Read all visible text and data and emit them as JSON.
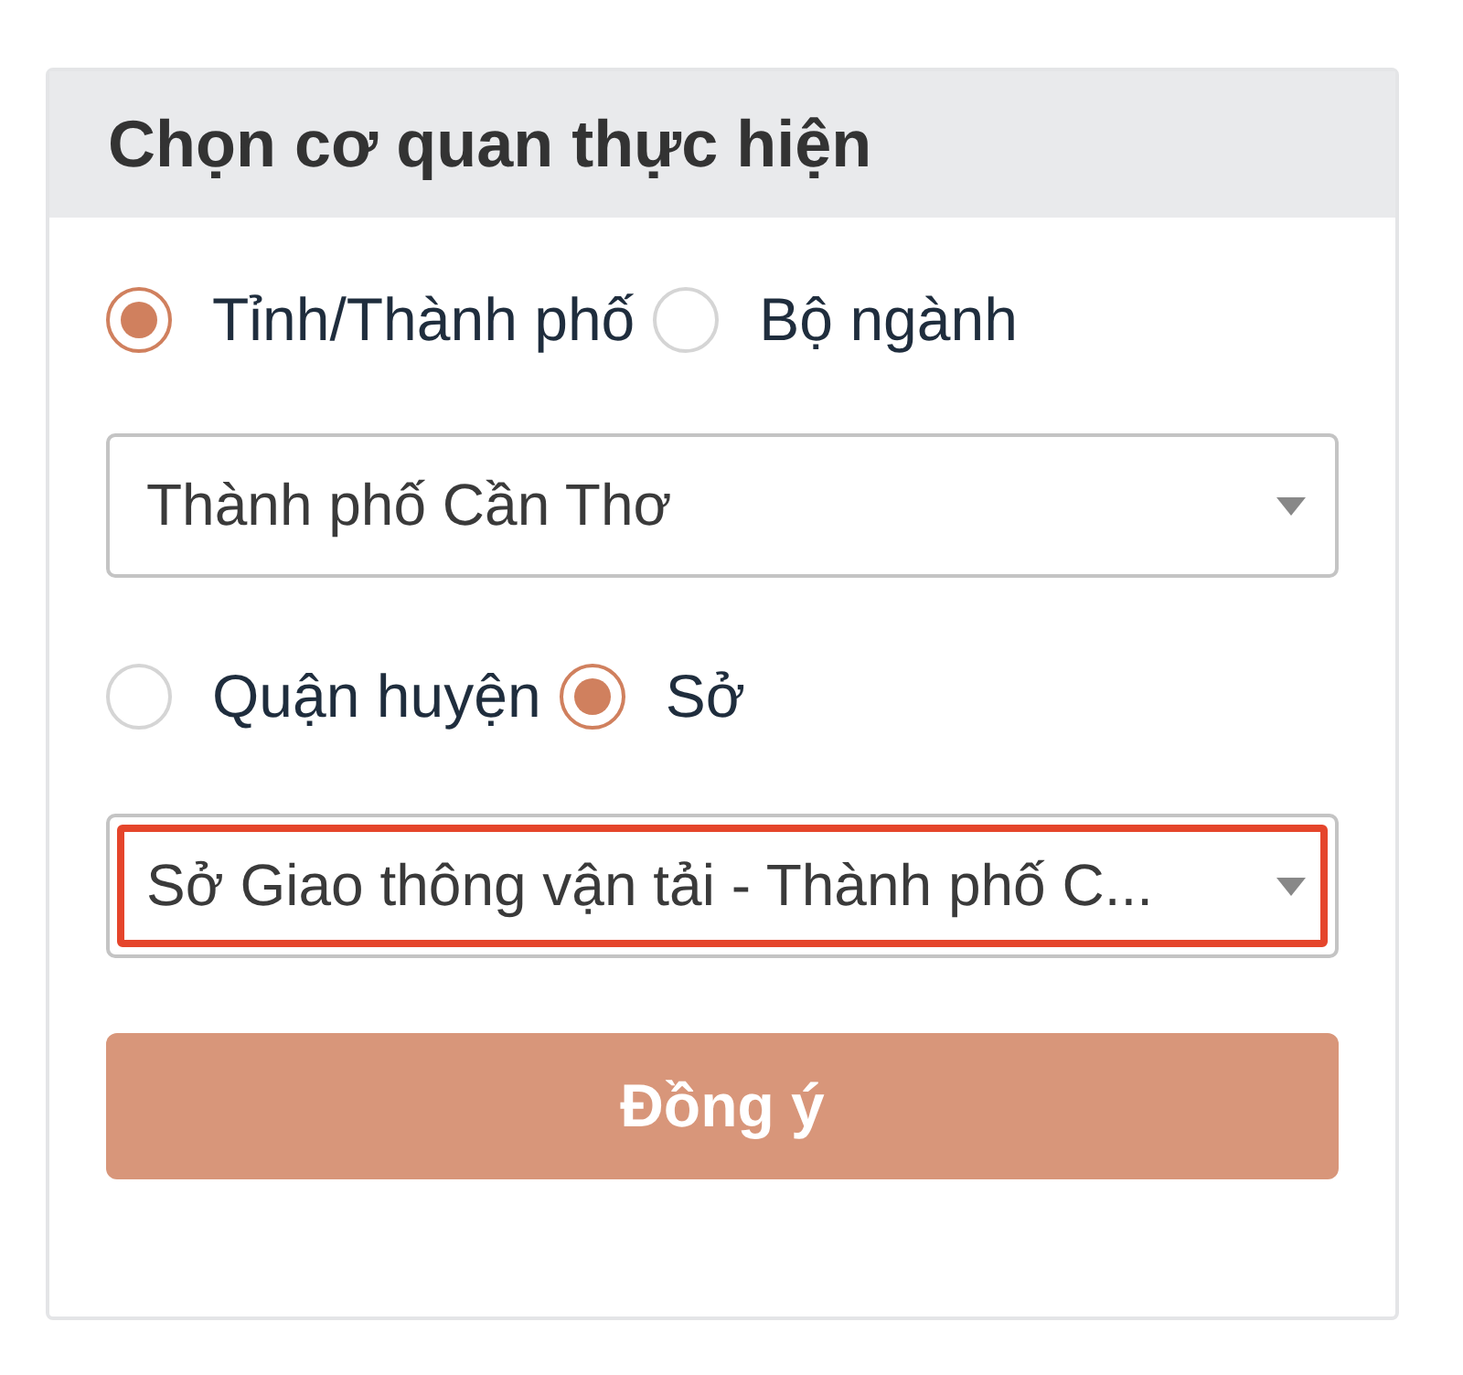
{
  "panel": {
    "title": "Chọn cơ quan thực hiện"
  },
  "level_options": [
    {
      "label": "Tỉnh/Thành phố",
      "selected": true
    },
    {
      "label": "Bộ ngành",
      "selected": false
    }
  ],
  "province_select": {
    "value": "Thành phố Cần Thơ",
    "highlighted": false
  },
  "unit_options": [
    {
      "label": "Quận huyện",
      "selected": false
    },
    {
      "label": "Sở",
      "selected": true
    }
  ],
  "agency_select": {
    "value": "Sở Giao thông vận tải - Thành phố C...",
    "highlighted": true
  },
  "submit_button": {
    "label": "Đồng ý"
  }
}
